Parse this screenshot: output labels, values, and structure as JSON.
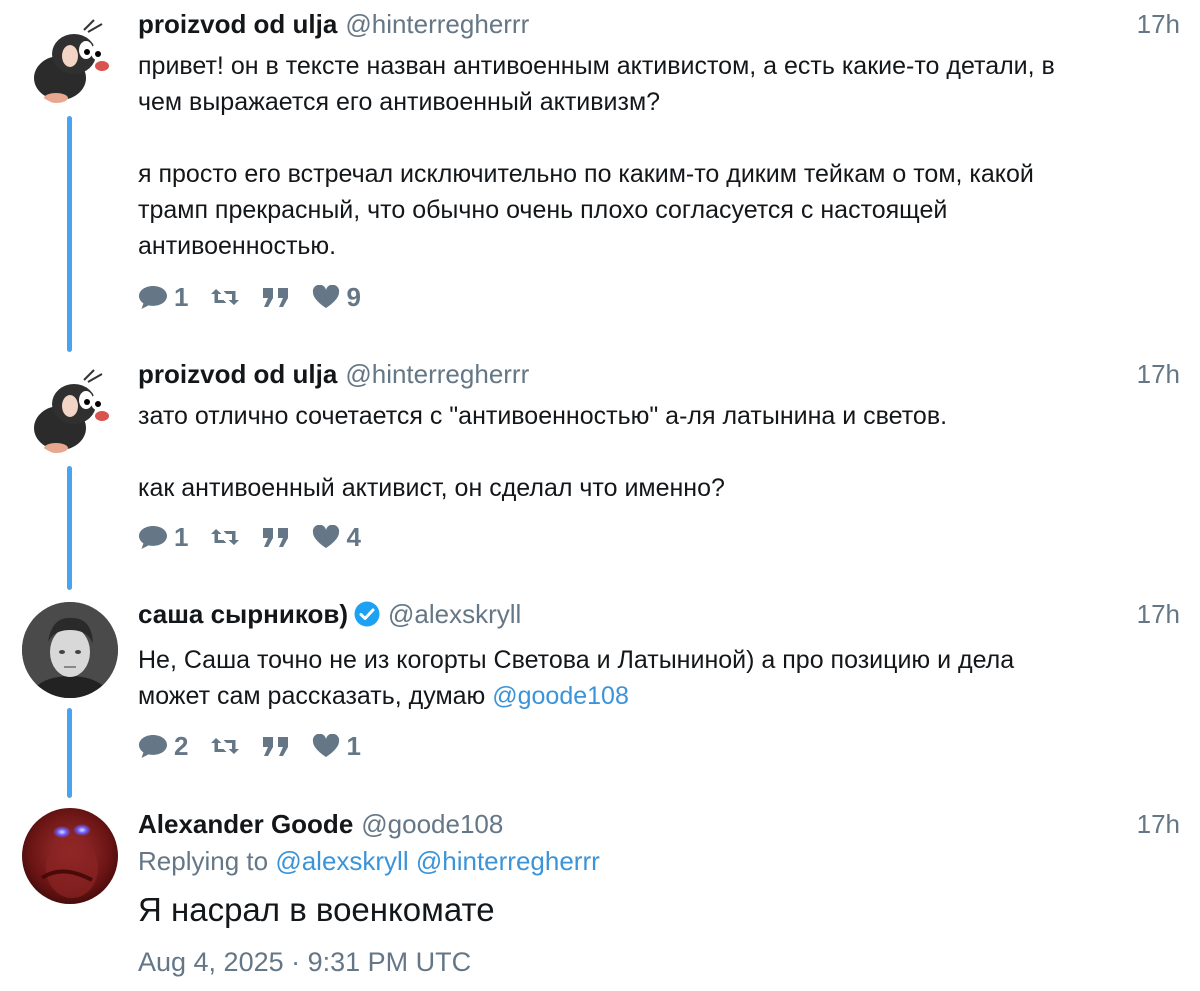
{
  "tweets": [
    {
      "name": "proizvod od ulja",
      "handle": "@hinterregherrr",
      "time": "17h",
      "text": "привет! он в тексте назван антивоенным активистом, а есть какие-то детали, в\nчем выражается его антивоенный активизм?\n\nя просто его встречал исключительно по каким-то диким тейкам о том, какой\nтрамп прекрасный, что обычно очень плохо согласуется с настоящей\nантивоенностью.",
      "replies": "1",
      "likes": "9",
      "avatar": "mole-avatar"
    },
    {
      "name": "proizvod od ulja",
      "handle": "@hinterregherrr",
      "time": "17h",
      "text": "зато отлично сочетается с \"антивоенностью\" а-ля латынина и светов.\n\nкак антивоенный активист, он сделал что именно?",
      "replies": "1",
      "likes": "4",
      "avatar": "mole-avatar"
    },
    {
      "name": "саша сырников)",
      "handle": "@alexskryll",
      "time": "17h",
      "text_before": "Не, Саша точно не из когорты Светова и Латыниной) а про позицию и дела\nможет сам рассказать, думаю ",
      "text_mention": "@goode108",
      "replies": "2",
      "likes": "1",
      "verified": true,
      "avatar": "person-photo-avatar"
    },
    {
      "name": "Alexander Goode",
      "handle": "@goode108",
      "time": "17h",
      "replying_label": "Replying to",
      "replying_to": [
        "@alexskryll",
        "@hinterregherrr"
      ],
      "text": "Я насрал в военкомате",
      "date": "Aug 4, 2025 · 9:31 PM UTC",
      "avatar": "red-glowing-eyes-avatar"
    }
  ],
  "colors": {
    "accent": "#4aa3ef",
    "link": "#3b94d9",
    "muted": "#657786",
    "text": "#14171a"
  }
}
